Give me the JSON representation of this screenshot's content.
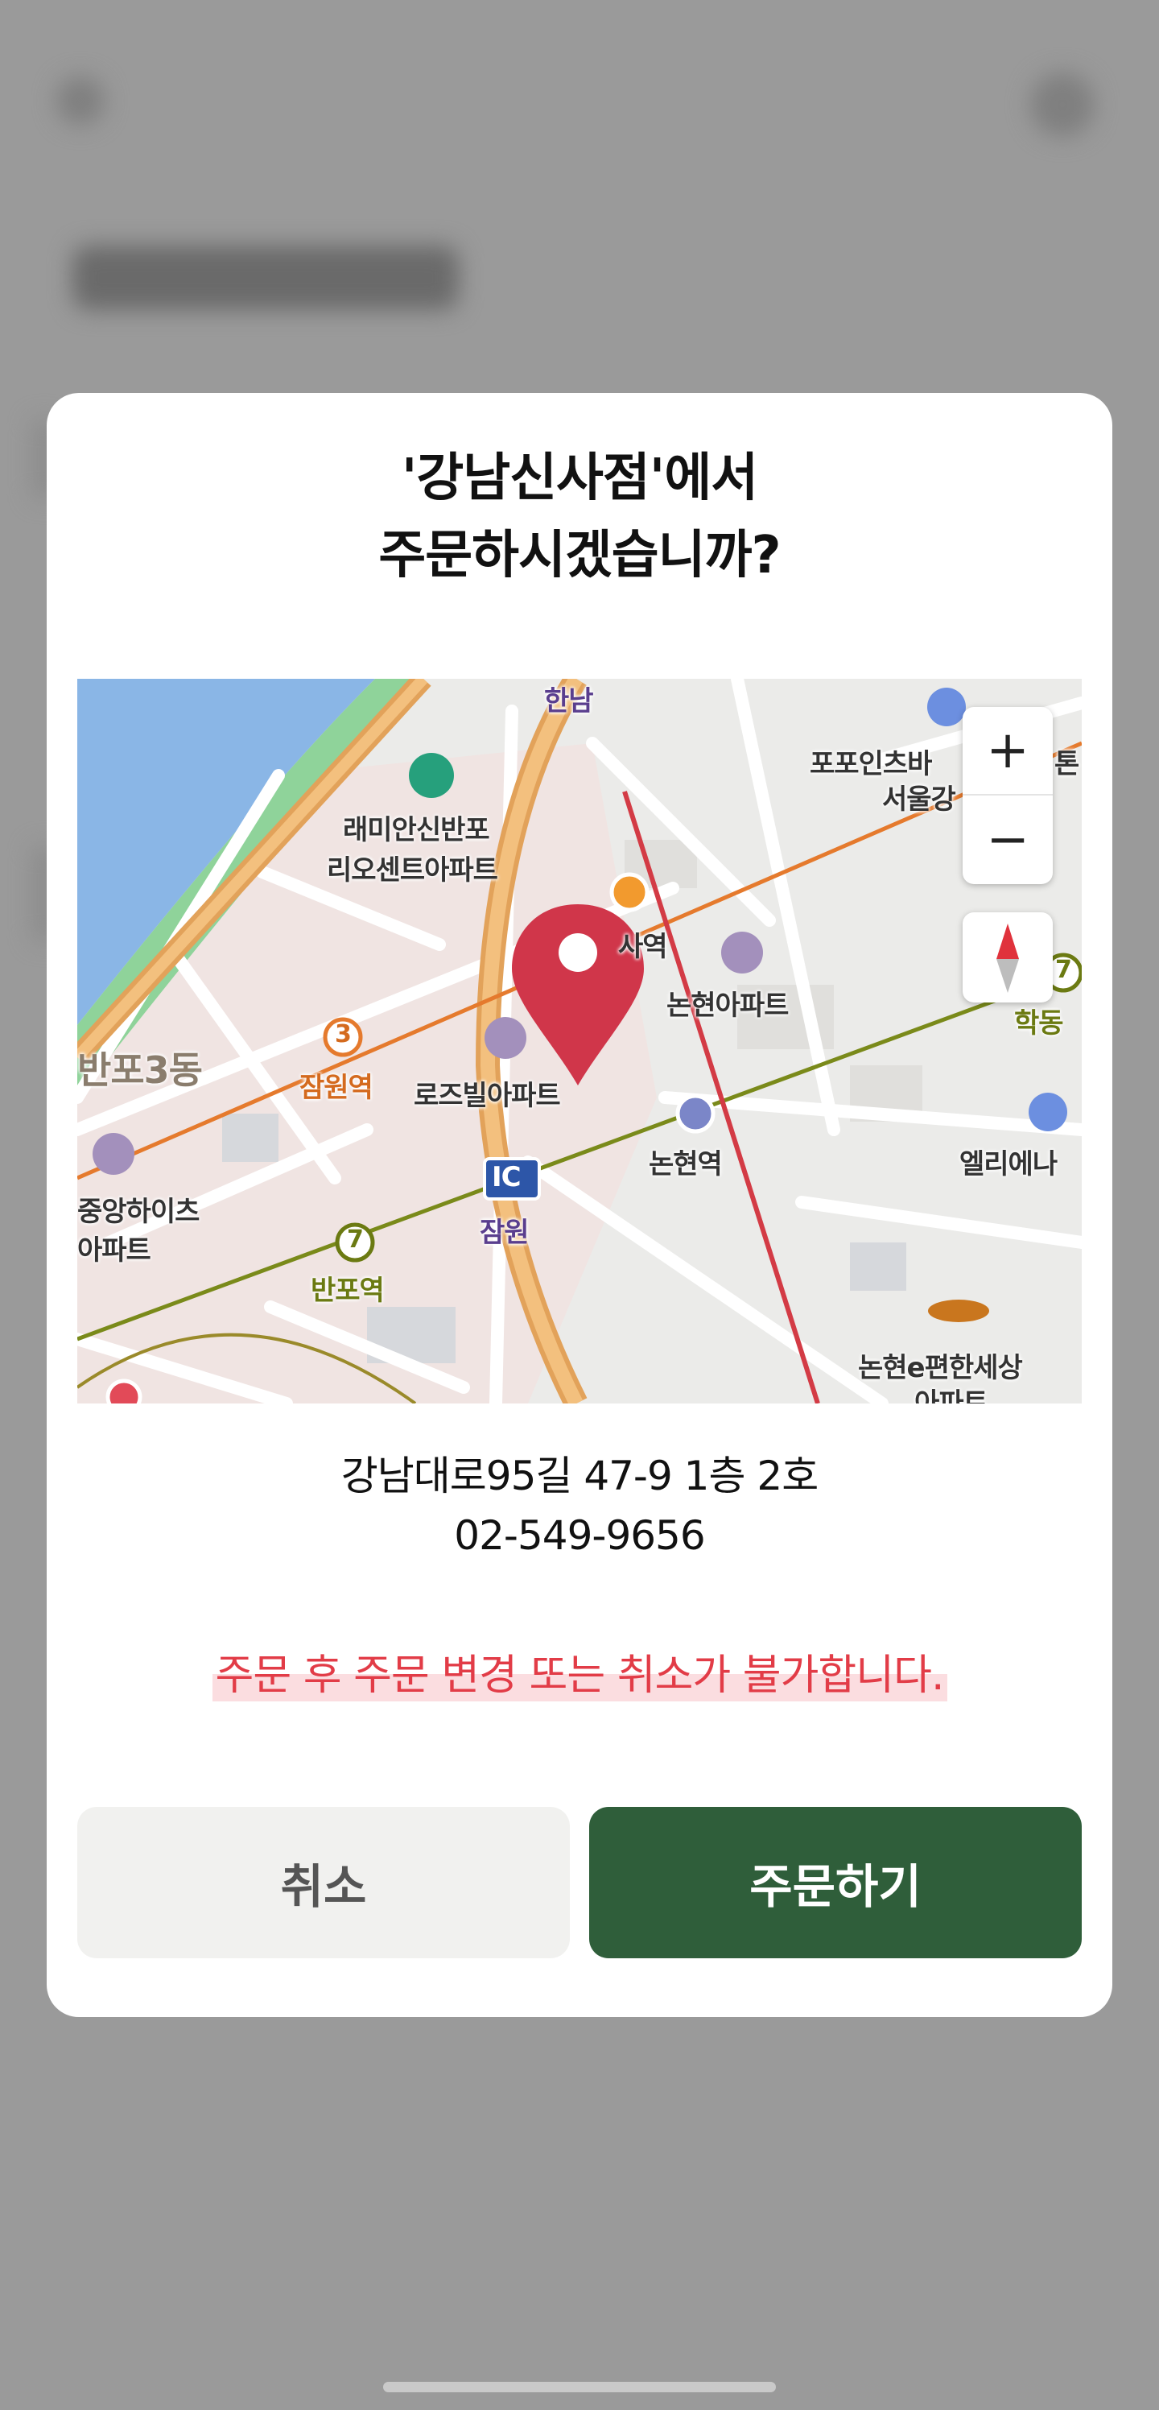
{
  "dialog": {
    "title_line1": "'강남신사점'에서",
    "title_line2": "주문하시겠습니까?",
    "address": "강남대로95길 47-9 1층 2호",
    "phone": "02-549-9656",
    "warning": "주문 후 주문 변경 또는 취소가 불가합니다.",
    "cancel_label": "취소",
    "confirm_label": "주문하기"
  },
  "map": {
    "labels": {
      "hannam": "한남",
      "popoinseu": "포포인츠바",
      "popoinseu_suffix": "톤",
      "seoulgang": "서울강",
      "raemian1": "래미안신반포",
      "raemian2": "리오센트아파트",
      "sinsa": "사역",
      "nonhyeon_apt": "논현아파트",
      "hakdong": "학동",
      "banpo3": "반포3동",
      "jamwon_station": "잠원역",
      "rosevil": "로즈빌아파트",
      "nonhyeon_station": "논현역",
      "ellie": "엘리에나",
      "jungang1": "중앙하이츠",
      "jungang2": "아파트",
      "ic": "IC",
      "jamwon": "잠원",
      "banpo_station": "반포역",
      "nonhyeon_e1": "논현e편한세상",
      "nonhyeon_e2": "아파트",
      "line3": "3",
      "line7a": "7",
      "line7b": "7"
    },
    "zoom_in": "+",
    "zoom_out": "−"
  },
  "colors": {
    "accent": "#2f5e3a",
    "warning": "#e23c47",
    "pin": "#d0364a",
    "backdrop": "#9a9a9a"
  }
}
